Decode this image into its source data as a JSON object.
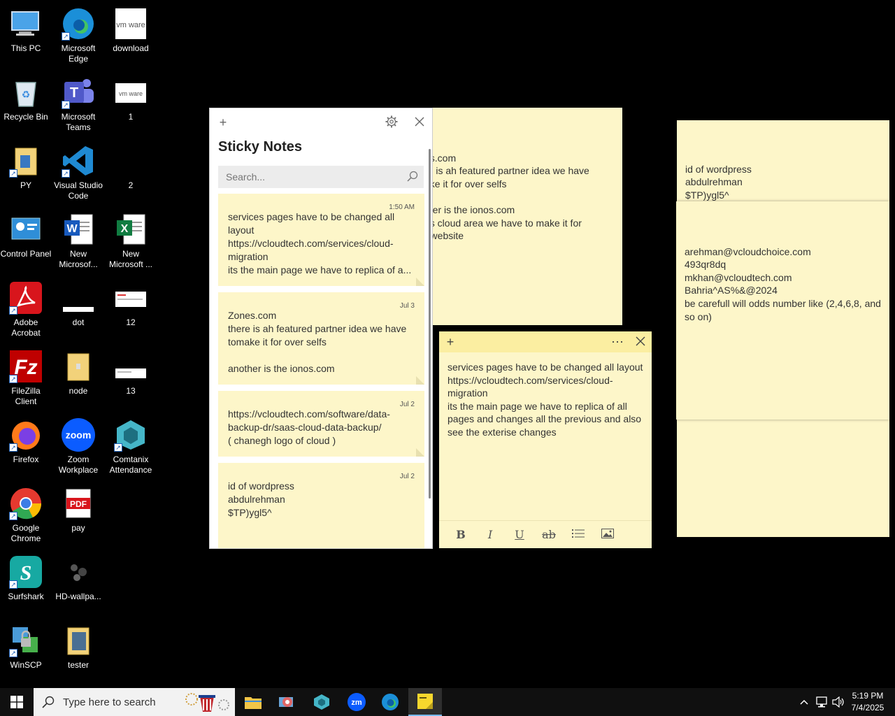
{
  "desktop": {
    "icons": [
      {
        "label": "This PC",
        "icon": "this-pc-icon"
      },
      {
        "label": "Microsoft Edge",
        "icon": "edge-icon"
      },
      {
        "label": "download",
        "icon": "vmware-icon"
      },
      {
        "label": "Recycle Bin",
        "icon": "recycle-bin-icon"
      },
      {
        "label": "Microsoft Teams",
        "icon": "teams-icon"
      },
      {
        "label": "1",
        "icon": "vmware-icon"
      },
      {
        "label": "PY",
        "icon": "folder-icon"
      },
      {
        "label": "Visual Studio Code",
        "icon": "vscode-icon"
      },
      {
        "label": "2",
        "icon": "blank-icon"
      },
      {
        "label": "Control Panel",
        "icon": "control-panel-icon"
      },
      {
        "label": "New Microsof...",
        "icon": "word-icon"
      },
      {
        "label": "New Microsoft ...",
        "icon": "excel-icon"
      },
      {
        "label": "Adobe Acrobat",
        "icon": "acrobat-icon"
      },
      {
        "label": "dot",
        "icon": "image-icon"
      },
      {
        "label": "12",
        "icon": "screenshot-icon"
      },
      {
        "label": "FileZilla Client",
        "icon": "filezilla-icon"
      },
      {
        "label": "node",
        "icon": "folder-icon"
      },
      {
        "label": "13",
        "icon": "screenshot-icon"
      },
      {
        "label": "Firefox",
        "icon": "firefox-icon"
      },
      {
        "label": "Zoom Workplace",
        "icon": "zoom-icon"
      },
      {
        "label": "Comtanix Attendance",
        "icon": "comtanix-icon"
      },
      {
        "label": "Google Chrome",
        "icon": "chrome-icon"
      },
      {
        "label": "pay",
        "icon": "pdf-icon"
      },
      {
        "label": "Surfshark",
        "icon": "surfshark-icon"
      },
      {
        "label": "HD-wallpa...",
        "icon": "wallpaper-icon"
      },
      {
        "label": "WinSCP",
        "icon": "winscp-icon"
      },
      {
        "label": "tester",
        "icon": "folder-icon"
      }
    ],
    "vmware_text": "vm ware",
    "pdf_text": "PDF",
    "zoom_text": "zoom"
  },
  "sticky_list": {
    "title": "Sticky Notes",
    "search_placeholder": "Search...",
    "notes": [
      {
        "date": "1:50 AM",
        "text": "services pages have to be changed all layout\nhttps://vcloudtech.com/services/cloud-migration\nits the main page  we have to replica of a..."
      },
      {
        "date": "Jul 3",
        "text": "Zones.com\nthere is ah featured partner idea we have tomake it for over selfs\n\nanother is the ionos.com"
      },
      {
        "date": "Jul 2",
        "text": "https://vcloudtech.com/software/data-backup-dr/saas-cloud-data-backup/\n( chanegh logo of cloud )"
      },
      {
        "date": "Jul 2",
        "text": "id of wordpress\nabdulrehman\n$TP)ygl5^"
      }
    ]
  },
  "open_notes": {
    "zones_partial": "es.com\nre is ah featured partner idea we have\nake it for over selfs\n\nther is the ionos.com\nos cloud  area we have to make it for\nr  website",
    "wordpress": "id of wordpress\nabdulrehman\n$TP)ygl5^",
    "emails": "arehman@vcloudchoice.com\n493qr8dq\nmkhan@vcloudtech.com\nBahria^AS%&@2024\nbe carefull will odds number like (2,4,6,8, and so on)",
    "main": "services pages have to be changed all layout\nhttps://vcloudtech.com/services/cloud-migration\nits the main page  we have to replica of all pages and changes all the previous and also see the  exterise changes",
    "format_buttons": [
      "B",
      "I",
      "U",
      "ab"
    ]
  },
  "taskbar": {
    "search_text": "Type here to search",
    "time": "5:19 PM",
    "date": "7/4/2025",
    "apps": [
      "file-explorer-icon",
      "remote-desktop-icon",
      "comtanix-icon",
      "zoom-icon",
      "edge-icon",
      "sticky-notes-icon"
    ]
  },
  "colors": {
    "note_bg": "#fdf6c9",
    "note_bar": "#fbeea1",
    "taskbar": "#101010"
  }
}
